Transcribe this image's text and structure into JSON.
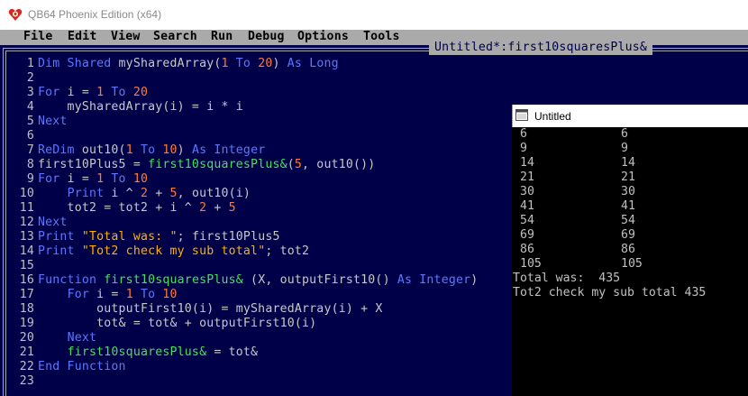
{
  "app": {
    "title": "QB64 Phoenix Edition (x64)"
  },
  "menu": [
    "File",
    "Edit",
    "View",
    "Search",
    "Run",
    "Debug",
    "Options",
    "Tools"
  ],
  "editor": {
    "tab_title": "Untitled*:first10squaresPlus&",
    "lines": [
      {
        "n": "1",
        "t": [
          [
            "kw",
            "Dim Shared "
          ],
          [
            "tx",
            "mySharedArray("
          ],
          [
            "num",
            "1"
          ],
          [
            "kw",
            " To "
          ],
          [
            "num",
            "20"
          ],
          [
            "tx",
            ") "
          ],
          [
            "kw",
            "As Long"
          ]
        ]
      },
      {
        "n": "2",
        "t": []
      },
      {
        "n": "3",
        "t": [
          [
            "kw",
            "For "
          ],
          [
            "tx",
            "i = "
          ],
          [
            "num",
            "1"
          ],
          [
            "kw",
            " To "
          ],
          [
            "num",
            "20"
          ]
        ]
      },
      {
        "n": "4",
        "t": [
          [
            "tx",
            "    mySharedArray(i) = i * i"
          ]
        ]
      },
      {
        "n": "5",
        "t": [
          [
            "kw",
            "Next"
          ]
        ]
      },
      {
        "n": "6",
        "t": []
      },
      {
        "n": "7",
        "t": [
          [
            "kw",
            "ReDim "
          ],
          [
            "tx",
            "out10("
          ],
          [
            "num",
            "1"
          ],
          [
            "kw",
            " To "
          ],
          [
            "num",
            "10"
          ],
          [
            "tx",
            ") "
          ],
          [
            "kw",
            "As Integer"
          ]
        ]
      },
      {
        "n": "8",
        "t": [
          [
            "tx",
            "first10Plus5 = "
          ],
          [
            "fn",
            "first10squaresPlus&"
          ],
          [
            "tx",
            "("
          ],
          [
            "num",
            "5"
          ],
          [
            "tx",
            ", out10())"
          ]
        ]
      },
      {
        "n": "9",
        "t": [
          [
            "kw",
            "For "
          ],
          [
            "tx",
            "i = "
          ],
          [
            "num",
            "1"
          ],
          [
            "kw",
            " To "
          ],
          [
            "num",
            "10"
          ]
        ]
      },
      {
        "n": "10",
        "t": [
          [
            "tx",
            "    "
          ],
          [
            "kw",
            "Print "
          ],
          [
            "tx",
            "i ^ "
          ],
          [
            "num",
            "2"
          ],
          [
            "tx",
            " + "
          ],
          [
            "num",
            "5"
          ],
          [
            "tx",
            ", out10(i)"
          ]
        ]
      },
      {
        "n": "11",
        "t": [
          [
            "tx",
            "    tot2 = tot2 + i ^ "
          ],
          [
            "num",
            "2"
          ],
          [
            "tx",
            " + "
          ],
          [
            "num",
            "5"
          ]
        ]
      },
      {
        "n": "12",
        "t": [
          [
            "kw",
            "Next"
          ]
        ]
      },
      {
        "n": "13",
        "t": [
          [
            "kw",
            "Print "
          ],
          [
            "str",
            "\"Total was: \""
          ],
          [
            "tx",
            "; first10Plus5"
          ]
        ]
      },
      {
        "n": "14",
        "t": [
          [
            "kw",
            "Print "
          ],
          [
            "str",
            "\"Tot2 check my sub total\""
          ],
          [
            "tx",
            "; tot2"
          ]
        ]
      },
      {
        "n": "15",
        "t": []
      },
      {
        "n": "16",
        "t": [
          [
            "kw",
            "Function "
          ],
          [
            "fn",
            "first10squaresPlus&"
          ],
          [
            "tx",
            " (X, outputFirst10() "
          ],
          [
            "kw",
            "As Integer"
          ],
          [
            "tx",
            ")"
          ]
        ]
      },
      {
        "n": "17",
        "t": [
          [
            "tx",
            "    "
          ],
          [
            "kw",
            "For "
          ],
          [
            "tx",
            "i = "
          ],
          [
            "num",
            "1"
          ],
          [
            "kw",
            " To "
          ],
          [
            "num",
            "10"
          ]
        ]
      },
      {
        "n": "18",
        "t": [
          [
            "tx",
            "        outputFirst10(i) = mySharedArray(i) + X"
          ]
        ]
      },
      {
        "n": "19",
        "t": [
          [
            "tx",
            "        tot& = tot& + outputFirst10(i)"
          ]
        ]
      },
      {
        "n": "20",
        "t": [
          [
            "tx",
            "    "
          ],
          [
            "kw",
            "Next"
          ]
        ]
      },
      {
        "n": "21",
        "t": [
          [
            "tx",
            "    "
          ],
          [
            "fn",
            "first10squaresPlus&"
          ],
          [
            "tx",
            " = tot&"
          ]
        ]
      },
      {
        "n": "22",
        "t": [
          [
            "kw",
            "End Function"
          ]
        ]
      },
      {
        "n": "23",
        "t": []
      }
    ]
  },
  "output_window": {
    "title": "Untitled",
    "rows": [
      [
        "6",
        "6"
      ],
      [
        "9",
        "9"
      ],
      [
        "14",
        "14"
      ],
      [
        "21",
        "21"
      ],
      [
        "30",
        "30"
      ],
      [
        "41",
        "41"
      ],
      [
        "54",
        "54"
      ],
      [
        "69",
        "69"
      ],
      [
        "86",
        "86"
      ],
      [
        "105",
        "105"
      ]
    ],
    "total_line": "Total was:  435",
    "check_line": "Tot2 check my sub total 435"
  },
  "colors": {
    "editor_bg": "#000048",
    "keyword": "#5a78ff",
    "number": "#ff7a3d",
    "string": "#ffb000",
    "function": "#46e05a",
    "text": "#c8c8c8"
  }
}
